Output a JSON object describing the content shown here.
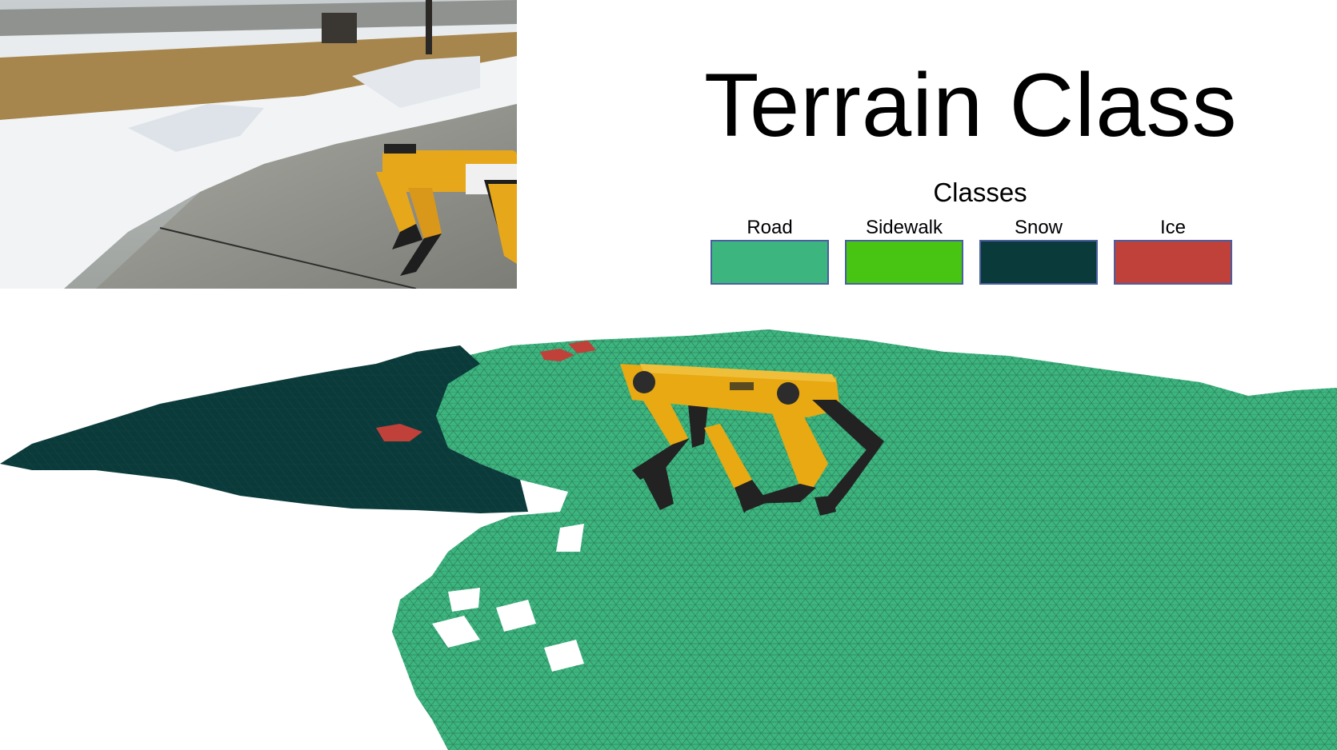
{
  "title": "Terrain Class",
  "legend": {
    "heading": "Classes",
    "items": [
      {
        "label": "Road",
        "color": "#3db57f"
      },
      {
        "label": "Sidewalk",
        "color": "#48c413"
      },
      {
        "label": "Snow",
        "color": "#0b3a3a"
      },
      {
        "label": "Ice",
        "color": "#c0403a"
      }
    ]
  },
  "colors": {
    "robot_body": "#e8a912",
    "robot_leg_dark": "#222222",
    "mesh_line": "#1e5a3f"
  }
}
